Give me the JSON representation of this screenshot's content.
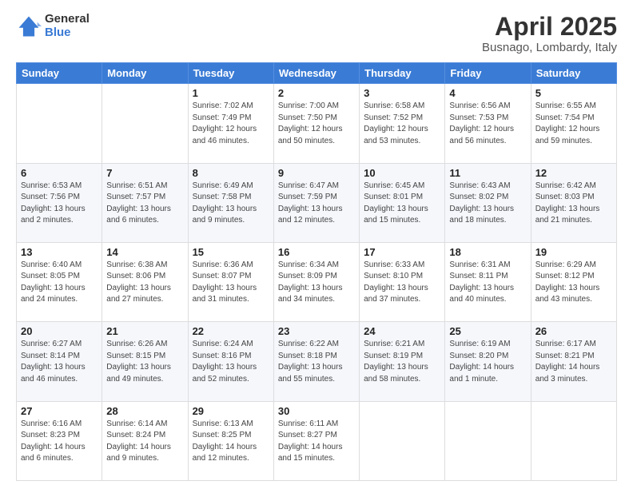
{
  "logo": {
    "general": "General",
    "blue": "Blue"
  },
  "title": {
    "month": "April 2025",
    "location": "Busnago, Lombardy, Italy"
  },
  "headers": [
    "Sunday",
    "Monday",
    "Tuesday",
    "Wednesday",
    "Thursday",
    "Friday",
    "Saturday"
  ],
  "weeks": [
    [
      {
        "day": "",
        "info": ""
      },
      {
        "day": "",
        "info": ""
      },
      {
        "day": "1",
        "info": "Sunrise: 7:02 AM\nSunset: 7:49 PM\nDaylight: 12 hours and 46 minutes."
      },
      {
        "day": "2",
        "info": "Sunrise: 7:00 AM\nSunset: 7:50 PM\nDaylight: 12 hours and 50 minutes."
      },
      {
        "day": "3",
        "info": "Sunrise: 6:58 AM\nSunset: 7:52 PM\nDaylight: 12 hours and 53 minutes."
      },
      {
        "day": "4",
        "info": "Sunrise: 6:56 AM\nSunset: 7:53 PM\nDaylight: 12 hours and 56 minutes."
      },
      {
        "day": "5",
        "info": "Sunrise: 6:55 AM\nSunset: 7:54 PM\nDaylight: 12 hours and 59 minutes."
      }
    ],
    [
      {
        "day": "6",
        "info": "Sunrise: 6:53 AM\nSunset: 7:56 PM\nDaylight: 13 hours and 2 minutes."
      },
      {
        "day": "7",
        "info": "Sunrise: 6:51 AM\nSunset: 7:57 PM\nDaylight: 13 hours and 6 minutes."
      },
      {
        "day": "8",
        "info": "Sunrise: 6:49 AM\nSunset: 7:58 PM\nDaylight: 13 hours and 9 minutes."
      },
      {
        "day": "9",
        "info": "Sunrise: 6:47 AM\nSunset: 7:59 PM\nDaylight: 13 hours and 12 minutes."
      },
      {
        "day": "10",
        "info": "Sunrise: 6:45 AM\nSunset: 8:01 PM\nDaylight: 13 hours and 15 minutes."
      },
      {
        "day": "11",
        "info": "Sunrise: 6:43 AM\nSunset: 8:02 PM\nDaylight: 13 hours and 18 minutes."
      },
      {
        "day": "12",
        "info": "Sunrise: 6:42 AM\nSunset: 8:03 PM\nDaylight: 13 hours and 21 minutes."
      }
    ],
    [
      {
        "day": "13",
        "info": "Sunrise: 6:40 AM\nSunset: 8:05 PM\nDaylight: 13 hours and 24 minutes."
      },
      {
        "day": "14",
        "info": "Sunrise: 6:38 AM\nSunset: 8:06 PM\nDaylight: 13 hours and 27 minutes."
      },
      {
        "day": "15",
        "info": "Sunrise: 6:36 AM\nSunset: 8:07 PM\nDaylight: 13 hours and 31 minutes."
      },
      {
        "day": "16",
        "info": "Sunrise: 6:34 AM\nSunset: 8:09 PM\nDaylight: 13 hours and 34 minutes."
      },
      {
        "day": "17",
        "info": "Sunrise: 6:33 AM\nSunset: 8:10 PM\nDaylight: 13 hours and 37 minutes."
      },
      {
        "day": "18",
        "info": "Sunrise: 6:31 AM\nSunset: 8:11 PM\nDaylight: 13 hours and 40 minutes."
      },
      {
        "day": "19",
        "info": "Sunrise: 6:29 AM\nSunset: 8:12 PM\nDaylight: 13 hours and 43 minutes."
      }
    ],
    [
      {
        "day": "20",
        "info": "Sunrise: 6:27 AM\nSunset: 8:14 PM\nDaylight: 13 hours and 46 minutes."
      },
      {
        "day": "21",
        "info": "Sunrise: 6:26 AM\nSunset: 8:15 PM\nDaylight: 13 hours and 49 minutes."
      },
      {
        "day": "22",
        "info": "Sunrise: 6:24 AM\nSunset: 8:16 PM\nDaylight: 13 hours and 52 minutes."
      },
      {
        "day": "23",
        "info": "Sunrise: 6:22 AM\nSunset: 8:18 PM\nDaylight: 13 hours and 55 minutes."
      },
      {
        "day": "24",
        "info": "Sunrise: 6:21 AM\nSunset: 8:19 PM\nDaylight: 13 hours and 58 minutes."
      },
      {
        "day": "25",
        "info": "Sunrise: 6:19 AM\nSunset: 8:20 PM\nDaylight: 14 hours and 1 minute."
      },
      {
        "day": "26",
        "info": "Sunrise: 6:17 AM\nSunset: 8:21 PM\nDaylight: 14 hours and 3 minutes."
      }
    ],
    [
      {
        "day": "27",
        "info": "Sunrise: 6:16 AM\nSunset: 8:23 PM\nDaylight: 14 hours and 6 minutes."
      },
      {
        "day": "28",
        "info": "Sunrise: 6:14 AM\nSunset: 8:24 PM\nDaylight: 14 hours and 9 minutes."
      },
      {
        "day": "29",
        "info": "Sunrise: 6:13 AM\nSunset: 8:25 PM\nDaylight: 14 hours and 12 minutes."
      },
      {
        "day": "30",
        "info": "Sunrise: 6:11 AM\nSunset: 8:27 PM\nDaylight: 14 hours and 15 minutes."
      },
      {
        "day": "",
        "info": ""
      },
      {
        "day": "",
        "info": ""
      },
      {
        "day": "",
        "info": ""
      }
    ]
  ]
}
